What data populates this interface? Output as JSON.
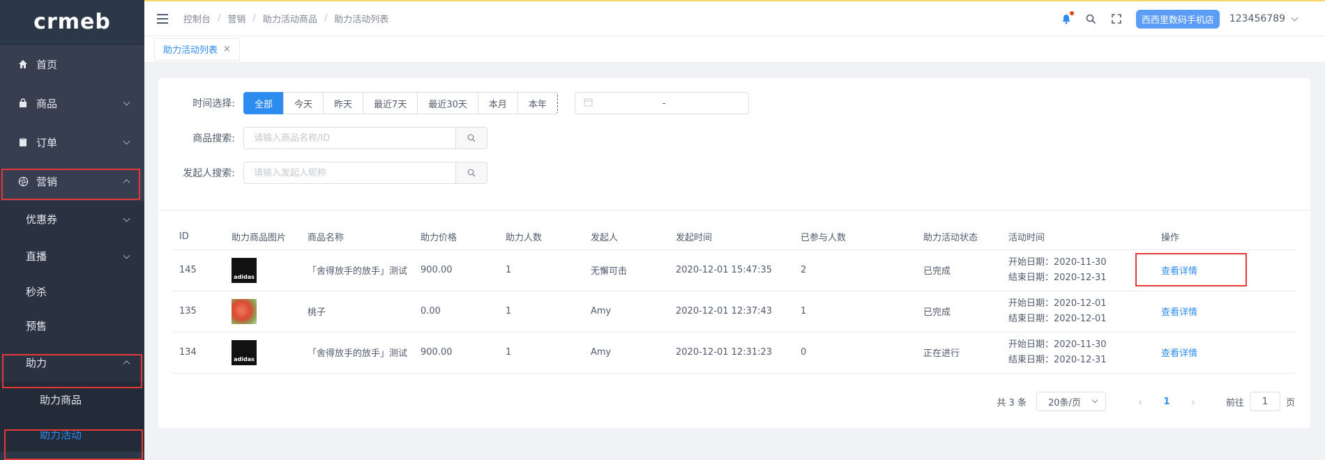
{
  "sidebar": {
    "logo": "crmeb",
    "menu": [
      {
        "label": "首页",
        "icon": "home-icon"
      },
      {
        "label": "商品",
        "icon": "shopping-bag-icon"
      },
      {
        "label": "订单",
        "icon": "clipboard-icon"
      },
      {
        "label": "营销",
        "icon": "aperture-icon"
      }
    ],
    "marketing_sub": [
      {
        "label": "优惠券"
      },
      {
        "label": "直播"
      },
      {
        "label": "秒杀"
      },
      {
        "label": "预售"
      },
      {
        "label": "助力"
      }
    ],
    "assist_sub": [
      {
        "label": "助力商品"
      },
      {
        "label": "助力活动"
      }
    ]
  },
  "header": {
    "breadcrumb": [
      "控制台",
      "营销",
      "助力活动商品",
      "助力活动列表"
    ],
    "shop": "西西里数码手机店",
    "user": "123456789"
  },
  "tabs": [
    {
      "label": "助力活动列表"
    }
  ],
  "filter": {
    "time_label": "时间选择:",
    "time_options": [
      "全部",
      "今天",
      "昨天",
      "最近7天",
      "最近30天",
      "本月",
      "本年"
    ],
    "date_sep": "-",
    "product_label": "商品搜索:",
    "product_placeholder": "请输入商品名称/ID",
    "initiator_label": "发起人搜索:",
    "initiator_placeholder": "请输入发起人昵称"
  },
  "table": {
    "headers": [
      "ID",
      "助力商品图片",
      "商品名称",
      "助力价格",
      "助力人数",
      "发起人",
      "发起时间",
      "已参与人数",
      "助力活动状态",
      "活动时间",
      "操作"
    ],
    "rows": [
      {
        "id": "145",
        "image": "adidas",
        "name": "「舍得放手的放手」测试",
        "price": "900.00",
        "count": "1",
        "initiator": "无懈可击",
        "time": "2020-12-01 15:47:35",
        "joined": "2",
        "status": "已完成",
        "start": "开始日期：2020-11-30",
        "end": "结束日期：2020-12-31",
        "action": "查看详情"
      },
      {
        "id": "135",
        "image": "peach",
        "name": "桃子",
        "price": "0.00",
        "count": "1",
        "initiator": "Amy",
        "time": "2020-12-01 12:37:43",
        "joined": "1",
        "status": "已完成",
        "start": "开始日期：2020-12-01",
        "end": "结束日期：2020-12-01",
        "action": "查看详情"
      },
      {
        "id": "134",
        "image": "adidas",
        "name": "「舍得放手的放手」测试",
        "price": "900.00",
        "count": "1",
        "initiator": "Amy",
        "time": "2020-12-01 12:31:23",
        "joined": "0",
        "status": "正在进行",
        "start": "开始日期：2020-11-30",
        "end": "结束日期：2020-12-31",
        "action": "查看详情"
      }
    ]
  },
  "pager": {
    "total": "共 3 条",
    "page_size": "20条/页",
    "current": "1",
    "goto_label": "前往",
    "goto_value": "1",
    "page_unit": "页"
  }
}
